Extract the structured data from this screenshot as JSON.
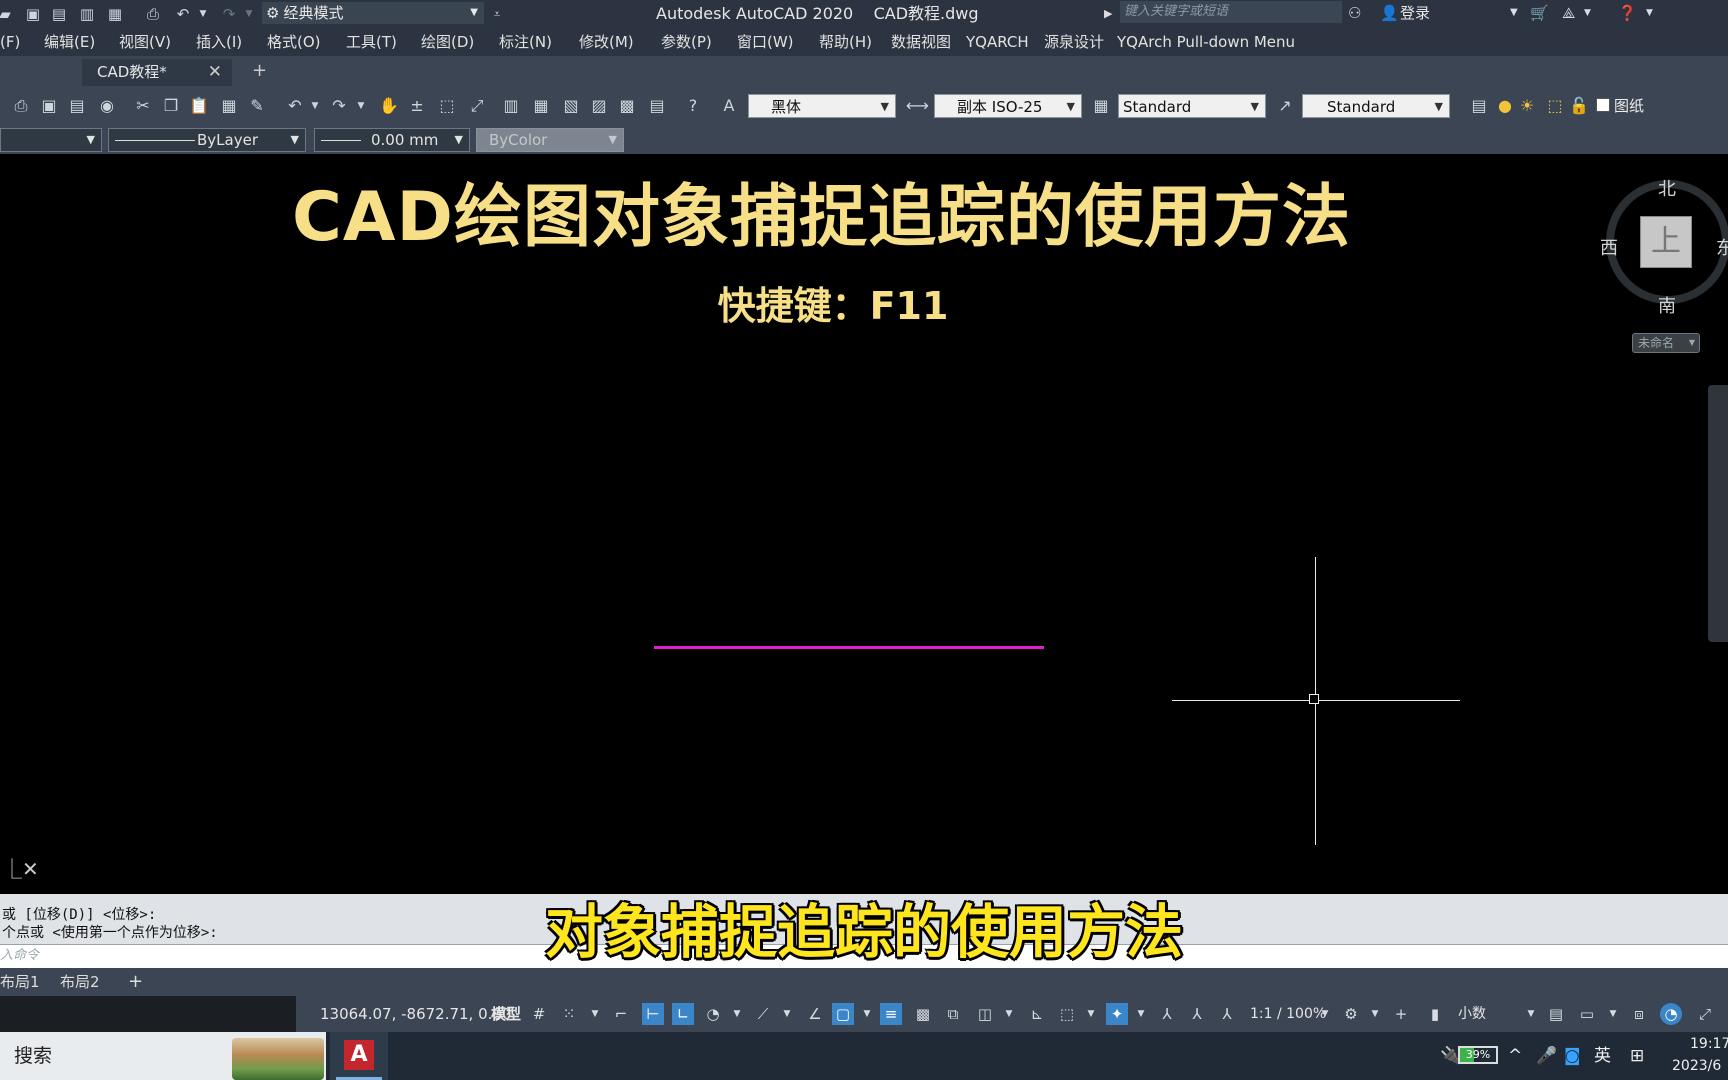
{
  "titlebar": {
    "workspace": "经典模式",
    "app_title": "Autodesk AutoCAD 2020    CAD教程.dwg",
    "search_placeholder": "键入关键字或短语",
    "login": "登录"
  },
  "menu": [
    "(F)",
    "编辑(E)",
    "视图(V)",
    "插入(I)",
    "格式(O)",
    "工具(T)",
    "绘图(D)",
    "标注(N)",
    "修改(M)",
    "参数(P)",
    "窗口(W)",
    "帮助(H)",
    "数据视图",
    "YQARCH",
    "源泉设计",
    "YQArch Pull-down Menu"
  ],
  "tabs": {
    "document": "CAD教程*",
    "close": "✕",
    "add": "+"
  },
  "toolbar1": {
    "font": "黑体",
    "dim_style": "副本 ISO-25",
    "table_style": "Standard",
    "mleader_style": "Standard",
    "paper_label": "图纸"
  },
  "toolbar2": {
    "linetype": "ByLayer",
    "lineweight": "0.00 mm",
    "plot_color": "ByColor"
  },
  "canvas": {
    "title": "CAD绘图对象捕捉追踪的使用方法",
    "shortcut": "快捷键：F11",
    "line_color": "#e01ecb"
  },
  "viewcube": {
    "north": "北",
    "south": "南",
    "west": "西",
    "east": "东",
    "face": "上",
    "wcs": "未命名"
  },
  "command": {
    "history_1": "或 [位移(D)] <位移>:",
    "history_2": "个点或 <使用第一个点作为位移>:",
    "input_placeholder": "入命令"
  },
  "subtitle": "对象捕捉追踪的使用方法",
  "layout_tabs": [
    "布局1",
    "布局2",
    "+"
  ],
  "statusbar": {
    "coords": "13064.07, -8672.71, 0.00",
    "model": "模型",
    "scale": "1:1 / 100%",
    "units": "小数"
  },
  "taskbar": {
    "search": "搜索",
    "autocad_icon": "A",
    "battery_pct": "39%",
    "battery_level": 0.39,
    "ime": "英",
    "time": "19:17",
    "date": "2023/6"
  }
}
